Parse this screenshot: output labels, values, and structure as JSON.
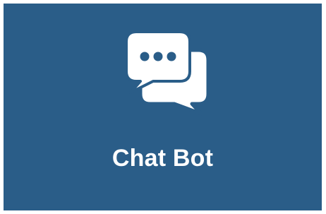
{
  "tile": {
    "label": "Chat Bot",
    "icon": "chat-bubbles-icon",
    "background_color": "#2a5d88",
    "text_color": "#ffffff"
  }
}
